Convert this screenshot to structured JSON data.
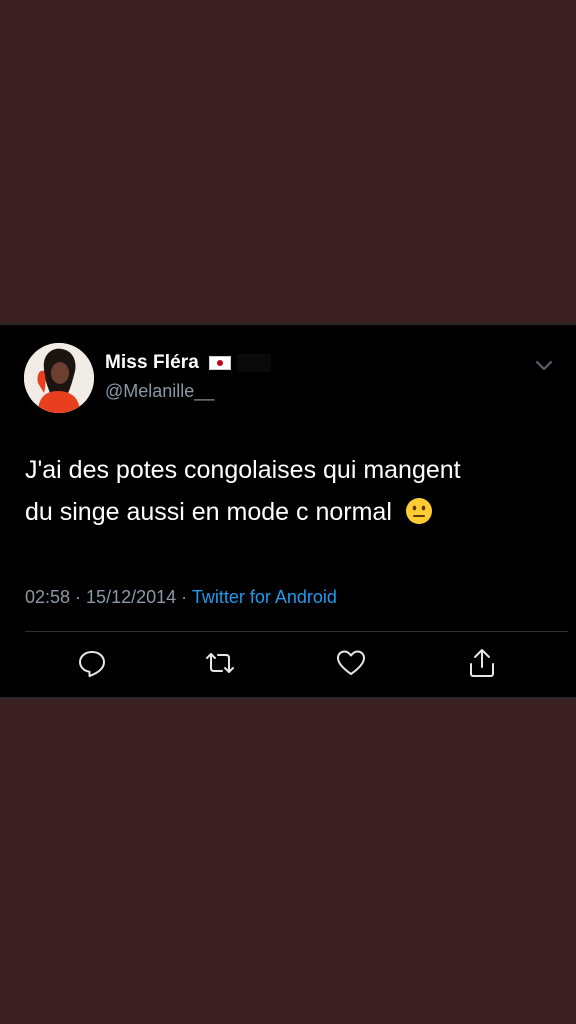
{
  "tweet": {
    "author": {
      "display_name": "Miss Fléra",
      "handle": "@Melanille__"
    },
    "text_line_1": "J'ai des potes congolaises qui mangent",
    "text_line_2": "du singe aussi en mode c normal",
    "emoji": "neutral-face",
    "time": "02:58",
    "separator_1": " · ",
    "date": "15/12/2014",
    "separator_2": " · ",
    "source": "Twitter for Android"
  },
  "actions": [
    "reply",
    "retweet",
    "like",
    "share"
  ],
  "colors": {
    "background": "#3b2022",
    "card": "#000000",
    "text": "#ffffff",
    "muted": "#8b98a5",
    "link": "#1d9bf0"
  }
}
